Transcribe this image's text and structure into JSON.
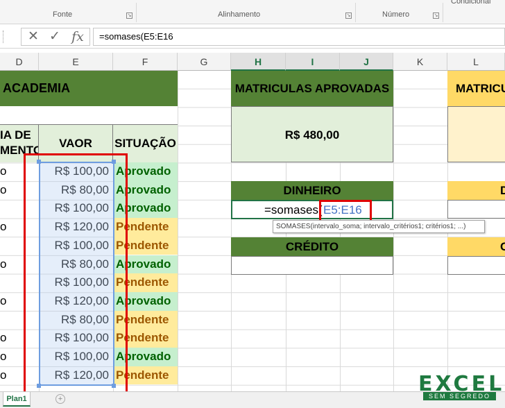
{
  "ribbon": {
    "groups": [
      "Fonte",
      "Alinhamento",
      "Número",
      "Condicional"
    ]
  },
  "formula_bar": {
    "cancel_icon": "✕",
    "enter_icon": "✓",
    "fx_icon": "fx",
    "formula": "=somases(E5:E16"
  },
  "columns": [
    "D",
    "E",
    "F",
    "G",
    "H",
    "I",
    "J",
    "K",
    "L"
  ],
  "table": {
    "title": "ACADEMIA",
    "col_d_header": "IA DE\nMENTO",
    "col_e_header": "VAOR",
    "col_f_header": "SITUAÇÃO",
    "d_cells": [
      "o",
      "o",
      "",
      "o",
      "",
      "o",
      "",
      "o",
      "",
      "o",
      "o",
      "o"
    ],
    "values": [
      "R$ 100,00",
      "R$ 80,00",
      "R$ 100,00",
      "R$ 120,00",
      "R$ 100,00",
      "R$ 80,00",
      "R$ 100,00",
      "R$ 120,00",
      "R$ 80,00",
      "R$ 100,00",
      "R$ 100,00",
      "R$ 120,00"
    ],
    "statuses": [
      "Aprovado",
      "Aprovado",
      "Aprovado",
      "Pendente",
      "Pendente",
      "Aprovado",
      "Pendente",
      "Aprovado",
      "Pendente",
      "Pendente",
      "Aprovado",
      "Pendente"
    ]
  },
  "summary": {
    "approved_title": "MATRICULAS APROVADAS",
    "approved_value": "R$ 480,00",
    "pending_title_partial": "MATRICU",
    "cash_title": "DINHEIRO",
    "cash_editing_prefix": "=somases(",
    "cash_editing_ref": "E5:E16",
    "credit_title": "CRÉDITO",
    "gold_d": "D",
    "gold_c": "C"
  },
  "tooltip": {
    "text": "SOMASES(intervalo_soma; intervalo_critérios1; critérios1; ...)"
  },
  "sheet_tabs": {
    "active": "Plan1",
    "add_icon": "+"
  },
  "logo": {
    "main": "EXCEL",
    "sub": "SEM SEGREDO"
  }
}
